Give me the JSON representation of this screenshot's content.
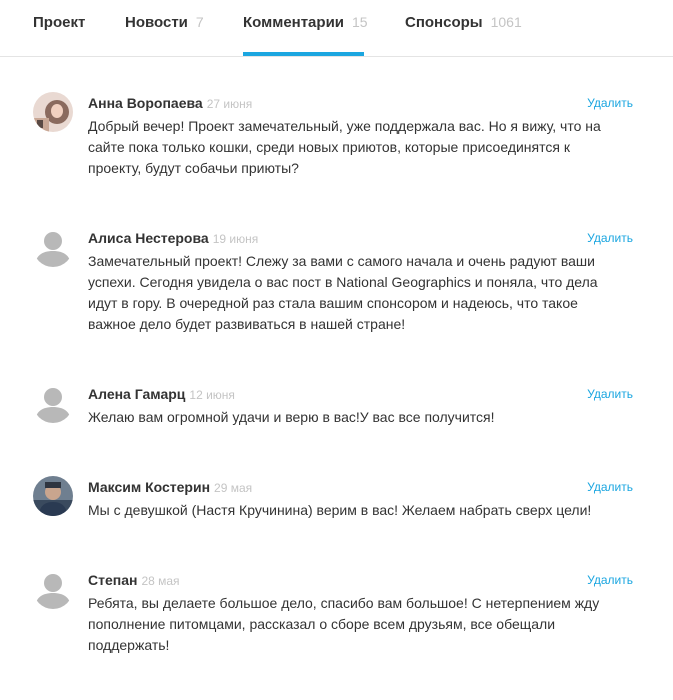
{
  "tabs": [
    {
      "label": "Проект",
      "count": ""
    },
    {
      "label": "Новости",
      "count": "7"
    },
    {
      "label": "Комментарии",
      "count": "15"
    },
    {
      "label": "Спонсоры",
      "count": "1061"
    }
  ],
  "active_tab": "Комментарии",
  "colors": {
    "accent": "#1ba6e0",
    "muted": "#c4c4c4",
    "text": "#333333"
  },
  "comments": [
    {
      "author": "Анна Воропаева",
      "date": "27 июня",
      "delete_label": "Удалить",
      "avatar": "photo-avatar",
      "text": "Добрый вечер! Проект замечательный, уже поддержала вас. Но я вижу, что на сайте пока только кошки, среди новых приютов, которые присоединятся к проекту, будут собачьи приюты?"
    },
    {
      "author": "Алиса Нестерова",
      "date": "19 июня",
      "delete_label": "Удалить",
      "avatar": "default-user-icon",
      "text": "Замечательный проект! Слежу за вами с самого начала и очень радуют ваши успехи. Сегодня увидела о вас пост в National Geographics и поняла, что дела идут в гору. В очередной раз стала вашим спонсором и надеюсь, что такое важное дело будет развиваться в нашей стране!"
    },
    {
      "author": "Алена Гамарц",
      "date": "12 июня",
      "delete_label": "Удалить",
      "avatar": "default-user-icon",
      "text": "Желаю вам огромной удачи и верю в вас!У вас все получится!"
    },
    {
      "author": "Максим Костерин",
      "date": "29 мая",
      "delete_label": "Удалить",
      "avatar": "photo-avatar",
      "text": "Мы с девушкой (Настя Кручинина) верим в вас! Желаем набрать сверх цели!"
    },
    {
      "author": "Степан",
      "date": "28 мая",
      "delete_label": "Удалить",
      "avatar": "default-user-icon",
      "text": "Ребята, вы делаете большое дело, спасибо вам большое! С нетерпением жду пополнение питомцами, рассказал о сборе всем друзьям, все обещали поддержать!"
    }
  ]
}
